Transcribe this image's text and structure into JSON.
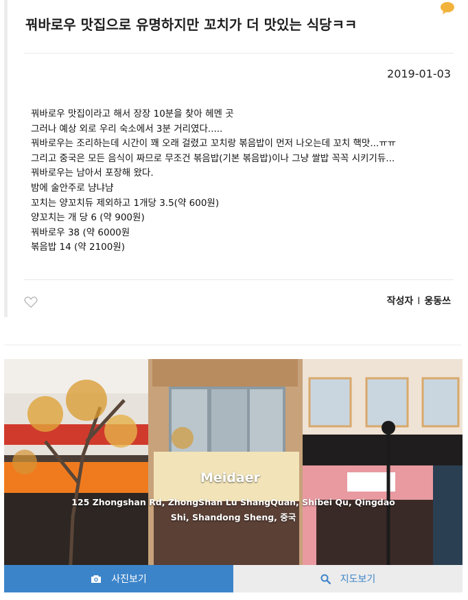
{
  "post": {
    "title": "꿔바로우 맛집으로 유명하지만 꼬치가 더 맛있는 식당ㅋㅋ",
    "date": "2019-01-03",
    "body_lines": [
      " 꿔바로우 맛집이라고 해서 장장 10분을 찾아 헤멘 곳",
      "그러나 예상 외로 우리 숙소에서 3분 거리였다.....",
      "꿔바로우는 조리하는데 시간이 꽤 오래 걸렸고 꼬치랑 볶음밥이 먼저 나오는데 꼬치 핵맛...ㅠㅠ",
      "그리고 중국은 모든 음식이 짜므로 무조건 볶음밥(기본 볶음밥)이나 그냥 쌀밥 꼭꼭 시키기듀...",
      "꿔바로우는 남아서 포장해 왔다.",
      "밤에 술안주로 냠냐냠",
      "꼬치는 양꼬치듀 제외하고 1개당 3.5(약 600원)",
      "양꼬치는 개 당 6 (약 900원)",
      "꿔바로우 38 (약 6000원",
      "볶음밥 14 (약 2100원)"
    ],
    "author_label": "작성자",
    "author_separator": "I",
    "author_name": "웅동쓰"
  },
  "place": {
    "sign_text": "Meidaer",
    "address_lines": [
      "125 Zhongshan Rd, ZhongShan Lu ShangQuan, Shibei Qu, Qingdao",
      "Shi, Shandong Sheng, 중국"
    ]
  },
  "buttons": {
    "photos_label": "사진보기",
    "map_label": "지도보기"
  },
  "icons": {
    "comment": "comment-icon",
    "like": "heart-icon",
    "camera": "camera-icon",
    "search": "search-icon"
  },
  "colors": {
    "accent": "#3c84c9",
    "comment_icon": "#f2b33d",
    "map_button_bg": "#ececec"
  }
}
